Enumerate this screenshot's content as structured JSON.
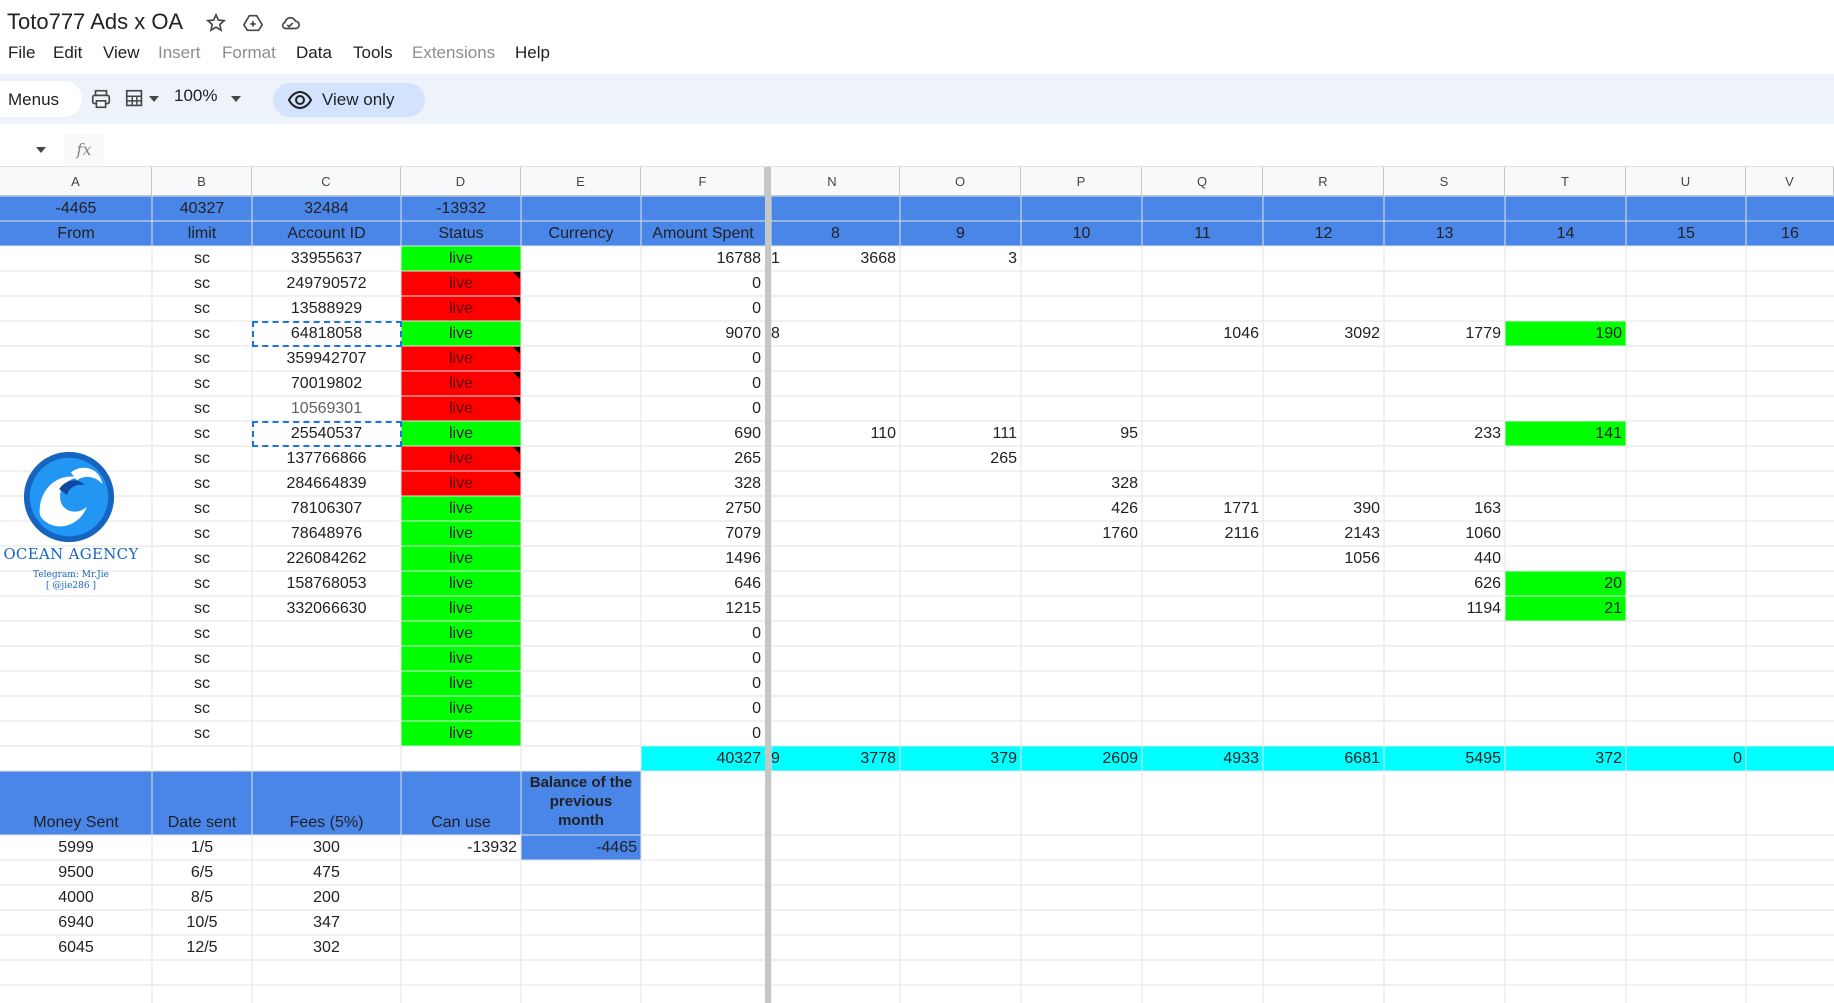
{
  "app": {
    "doc_title": "Toto777 Ads x OA",
    "menu": [
      "File",
      "Edit",
      "View",
      "Insert",
      "Format",
      "Data",
      "Tools",
      "Extensions",
      "Help"
    ],
    "menu_disabled": [
      "Insert",
      "Format",
      "Extensions"
    ]
  },
  "toolbar": {
    "menus_label": "Menus",
    "zoom": "100%",
    "view_only_label": "View only"
  },
  "formula_bar": {
    "fx": "fx"
  },
  "columns": [
    "A",
    "B",
    "C",
    "D",
    "E",
    "F",
    "N",
    "O",
    "P",
    "Q",
    "R",
    "S",
    "T",
    "U",
    "V"
  ],
  "summary_row": {
    "A": "-4465",
    "B": "40327",
    "C": "32484",
    "D": "-13932"
  },
  "header_row": {
    "A": "From",
    "B": "limit",
    "C": "Account ID",
    "D": "Status",
    "E": "Currency",
    "F": "Amount Spent",
    "days": [
      "8",
      "9",
      "10",
      "11",
      "12",
      "13",
      "14",
      "15",
      "16"
    ]
  },
  "logo": {
    "brand": "OCEAN AGENCY",
    "line1": "Telegram: Mr.Jie",
    "line2": "[ @jie286 ]"
  },
  "accounts": [
    {
      "limit": "sc",
      "id": "33955637",
      "status": "live",
      "status_color": "green",
      "spent": "16788",
      "g": "1",
      "days": [
        "3668",
        "3",
        "",
        "",
        "",
        "",
        ""
      ]
    },
    {
      "limit": "sc",
      "id": "249790572",
      "status": "live",
      "status_color": "red",
      "spent": "0",
      "g": "",
      "days": [
        "",
        "",
        "",
        "",
        "",
        "",
        ""
      ]
    },
    {
      "limit": "sc",
      "id": "13588929",
      "status": "live",
      "status_color": "red",
      "spent": "0",
      "g": "",
      "days": [
        "",
        "",
        "",
        "",
        "",
        "",
        ""
      ]
    },
    {
      "limit": "sc",
      "id": "64818058",
      "status": "live",
      "status_color": "green",
      "spent": "9070",
      "g": "8",
      "days": [
        "",
        "",
        "",
        "1046",
        "3092",
        "1779",
        "190"
      ]
    },
    {
      "limit": "sc",
      "id": "359942707",
      "status": "live",
      "status_color": "red",
      "spent": "0",
      "g": "",
      "days": [
        "",
        "",
        "",
        "",
        "",
        "",
        ""
      ]
    },
    {
      "limit": "sc",
      "id": "70019802",
      "status": "live",
      "status_color": "red",
      "spent": "0",
      "g": "",
      "days": [
        "",
        "",
        "",
        "",
        "",
        "",
        ""
      ]
    },
    {
      "limit": "sc",
      "id": "10569301",
      "status": "live",
      "status_color": "red",
      "spent": "0",
      "g": "",
      "days": [
        "",
        "",
        "",
        "",
        "",
        "",
        ""
      ]
    },
    {
      "limit": "sc",
      "id": "25540537",
      "status": "live",
      "status_color": "green",
      "spent": "690",
      "g": "",
      "days": [
        "110",
        "111",
        "95",
        "",
        "",
        "233",
        "141"
      ]
    },
    {
      "limit": "sc",
      "id": "137766866",
      "status": "live",
      "status_color": "red",
      "spent": "265",
      "g": "",
      "days": [
        "",
        "265",
        "",
        "",
        "",
        "",
        ""
      ]
    },
    {
      "limit": "sc",
      "id": "284664839",
      "status": "live",
      "status_color": "red",
      "spent": "328",
      "g": "",
      "days": [
        "",
        "",
        "328",
        "",
        "",
        "",
        ""
      ]
    },
    {
      "limit": "sc",
      "id": "78106307",
      "status": "live",
      "status_color": "green",
      "spent": "2750",
      "g": "",
      "days": [
        "",
        "",
        "426",
        "1771",
        "390",
        "163",
        ""
      ]
    },
    {
      "limit": "sc",
      "id": "78648976",
      "status": "live",
      "status_color": "green",
      "spent": "7079",
      "g": "",
      "days": [
        "",
        "",
        "1760",
        "2116",
        "2143",
        "1060",
        ""
      ]
    },
    {
      "limit": "sc",
      "id": "226084262",
      "status": "live",
      "status_color": "green",
      "spent": "1496",
      "g": "",
      "days": [
        "",
        "",
        "",
        "",
        "1056",
        "440",
        ""
      ]
    },
    {
      "limit": "sc",
      "id": "158768053",
      "status": "live",
      "status_color": "green",
      "spent": "646",
      "g": "",
      "days": [
        "",
        "",
        "",
        "",
        "",
        "626",
        "20"
      ]
    },
    {
      "limit": "sc",
      "id": "332066630",
      "status": "live",
      "status_color": "green",
      "spent": "1215",
      "g": "",
      "days": [
        "",
        "",
        "",
        "",
        "",
        "1194",
        "21"
      ]
    },
    {
      "limit": "sc",
      "id": "",
      "status": "live",
      "status_color": "green",
      "spent": "0",
      "g": "",
      "days": [
        "",
        "",
        "",
        "",
        "",
        "",
        ""
      ]
    },
    {
      "limit": "sc",
      "id": "",
      "status": "live",
      "status_color": "green",
      "spent": "0",
      "g": "",
      "days": [
        "",
        "",
        "",
        "",
        "",
        "",
        ""
      ]
    },
    {
      "limit": "sc",
      "id": "",
      "status": "live",
      "status_color": "green",
      "spent": "0",
      "g": "",
      "days": [
        "",
        "",
        "",
        "",
        "",
        "",
        ""
      ]
    },
    {
      "limit": "sc",
      "id": "",
      "status": "live",
      "status_color": "green",
      "spent": "0",
      "g": "",
      "days": [
        "",
        "",
        "",
        "",
        "",
        "",
        ""
      ]
    },
    {
      "limit": "sc",
      "id": "",
      "status": "live",
      "status_color": "green",
      "spent": "0",
      "g": "",
      "days": [
        "",
        "",
        "",
        "",
        "",
        "",
        ""
      ]
    }
  ],
  "totals_row": {
    "F": "40327",
    "g": "9",
    "days": [
      "3778",
      "379",
      "2609",
      "4933",
      "6681",
      "5495",
      "372",
      "0"
    ]
  },
  "payments_header": {
    "A": "Money Sent",
    "B": "Date sent",
    "C": "Fees (5%)",
    "D": "Can use",
    "E": "Balance of the previous month"
  },
  "payments": [
    {
      "sent": "5999",
      "date": "1/5",
      "fee": "300",
      "can_use": "-13932",
      "balance": "-4465"
    },
    {
      "sent": "9500",
      "date": "6/5",
      "fee": "475",
      "can_use": "",
      "balance": ""
    },
    {
      "sent": "4000",
      "date": "8/5",
      "fee": "200",
      "can_use": "",
      "balance": ""
    },
    {
      "sent": "6940",
      "date": "10/5",
      "fee": "347",
      "can_use": "",
      "balance": ""
    },
    {
      "sent": "6045",
      "date": "12/5",
      "fee": "302",
      "can_use": "",
      "balance": ""
    }
  ],
  "colors": {
    "header_blue": "#4a86e8",
    "live_green": "#00ff00",
    "live_red": "#ff0000",
    "totals_cyan": "#00ffff",
    "payments_blue": "#4a86e8"
  }
}
